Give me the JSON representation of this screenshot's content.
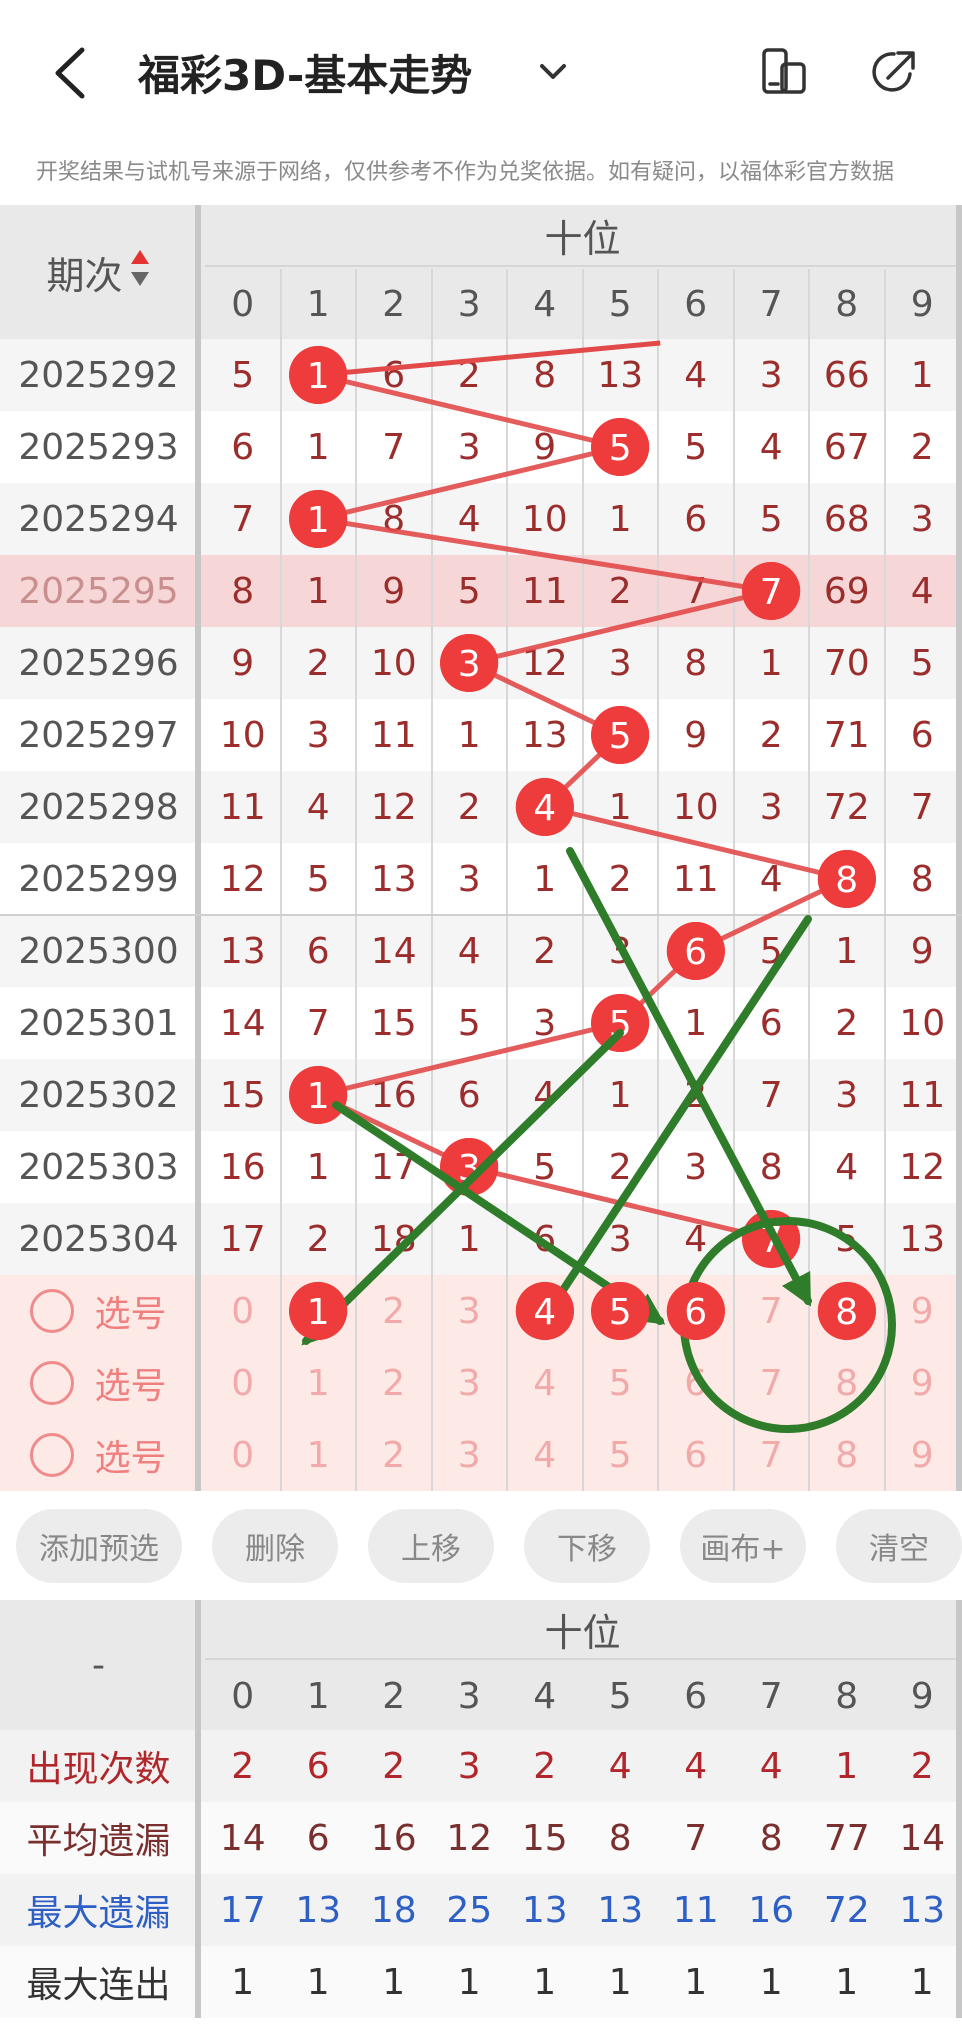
{
  "header": {
    "title": "福彩3D-基本走势",
    "notice": "开奖结果与试机号来源于网络，仅供参考不作为兑奖依据。如有疑问，以福体彩官方数据"
  },
  "trend": {
    "period_label": "期次",
    "group_label": "十位",
    "digits": [
      "0",
      "1",
      "2",
      "3",
      "4",
      "5",
      "6",
      "7",
      "8",
      "9"
    ],
    "rows": [
      {
        "period": "2025292",
        "values": [
          "5",
          "1",
          "6",
          "2",
          "8",
          "13",
          "4",
          "3",
          "66",
          "1"
        ],
        "hit": 1
      },
      {
        "period": "2025293",
        "values": [
          "6",
          "1",
          "7",
          "3",
          "9",
          "5",
          "5",
          "4",
          "67",
          "2"
        ],
        "hit": 5
      },
      {
        "period": "2025294",
        "values": [
          "7",
          "1",
          "8",
          "4",
          "10",
          "1",
          "6",
          "5",
          "68",
          "3"
        ],
        "hit": 1
      },
      {
        "period": "2025295",
        "values": [
          "8",
          "1",
          "9",
          "5",
          "11",
          "2",
          "7",
          "7",
          "69",
          "4"
        ],
        "hit": 7
      },
      {
        "period": "2025296",
        "values": [
          "9",
          "2",
          "10",
          "3",
          "12",
          "3",
          "8",
          "1",
          "70",
          "5"
        ],
        "hit": 3
      },
      {
        "period": "2025297",
        "values": [
          "10",
          "3",
          "11",
          "1",
          "13",
          "5",
          "9",
          "2",
          "71",
          "6"
        ],
        "hit": 5
      },
      {
        "period": "2025298",
        "values": [
          "11",
          "4",
          "12",
          "2",
          "4",
          "1",
          "10",
          "3",
          "72",
          "7"
        ],
        "hit": 4
      },
      {
        "period": "2025299",
        "values": [
          "12",
          "5",
          "13",
          "3",
          "1",
          "2",
          "11",
          "4",
          "8",
          "8"
        ],
        "hit": 8
      },
      {
        "period": "2025300",
        "values": [
          "13",
          "6",
          "14",
          "4",
          "2",
          "3",
          "6",
          "5",
          "1",
          "9"
        ],
        "hit": 6
      },
      {
        "period": "2025301",
        "values": [
          "14",
          "7",
          "15",
          "5",
          "3",
          "5",
          "1",
          "6",
          "2",
          "10"
        ],
        "hit": 5
      },
      {
        "period": "2025302",
        "values": [
          "15",
          "1",
          "16",
          "6",
          "4",
          "1",
          "2",
          "7",
          "3",
          "11"
        ],
        "hit": 1
      },
      {
        "period": "2025303",
        "values": [
          "16",
          "1",
          "17",
          "3",
          "5",
          "2",
          "3",
          "8",
          "4",
          "12"
        ],
        "hit": 3
      },
      {
        "period": "2025304",
        "values": [
          "17",
          "2",
          "18",
          "1",
          "6",
          "3",
          "4",
          "7",
          "5",
          "13"
        ],
        "hit": 7
      }
    ],
    "select_label": "选号",
    "select_rows": [
      {
        "values": [
          "0",
          "1",
          "2",
          "3",
          "4",
          "5",
          "6",
          "7",
          "8",
          "9"
        ],
        "picked": [
          1,
          4,
          5,
          6,
          8
        ]
      },
      {
        "values": [
          "0",
          "1",
          "2",
          "3",
          "4",
          "5",
          "6",
          "7",
          "8",
          "9"
        ],
        "picked": []
      },
      {
        "values": [
          "0",
          "1",
          "2",
          "3",
          "4",
          "5",
          "6",
          "7",
          "8",
          "9"
        ],
        "picked": []
      }
    ]
  },
  "actions": [
    "添加预选",
    "删除",
    "上移",
    "下移",
    "画布+",
    "清空"
  ],
  "stats": {
    "corner": "-",
    "group_label": "十位",
    "digits": [
      "0",
      "1",
      "2",
      "3",
      "4",
      "5",
      "6",
      "7",
      "8",
      "9"
    ],
    "rows": [
      {
        "label": "出现次数",
        "color": "#b0262b",
        "values": [
          "2",
          "6",
          "2",
          "3",
          "2",
          "4",
          "4",
          "4",
          "1",
          "2"
        ]
      },
      {
        "label": "平均遗漏",
        "color": "#7a2f2f",
        "values": [
          "14",
          "6",
          "16",
          "12",
          "15",
          "8",
          "7",
          "8",
          "77",
          "14"
        ]
      },
      {
        "label": "最大遗漏",
        "color": "#2d5fc4",
        "values": [
          "17",
          "13",
          "18",
          "25",
          "13",
          "13",
          "11",
          "16",
          "72",
          "13"
        ]
      },
      {
        "label": "最大连出",
        "color": "#333333",
        "values": [
          "1",
          "1",
          "1",
          "1",
          "1",
          "1",
          "1",
          "1",
          "1",
          "1"
        ]
      }
    ]
  },
  "colors": {
    "ball": "#ee3b3b",
    "line": "#e24a4a",
    "annotation": "#2f7d2b"
  }
}
